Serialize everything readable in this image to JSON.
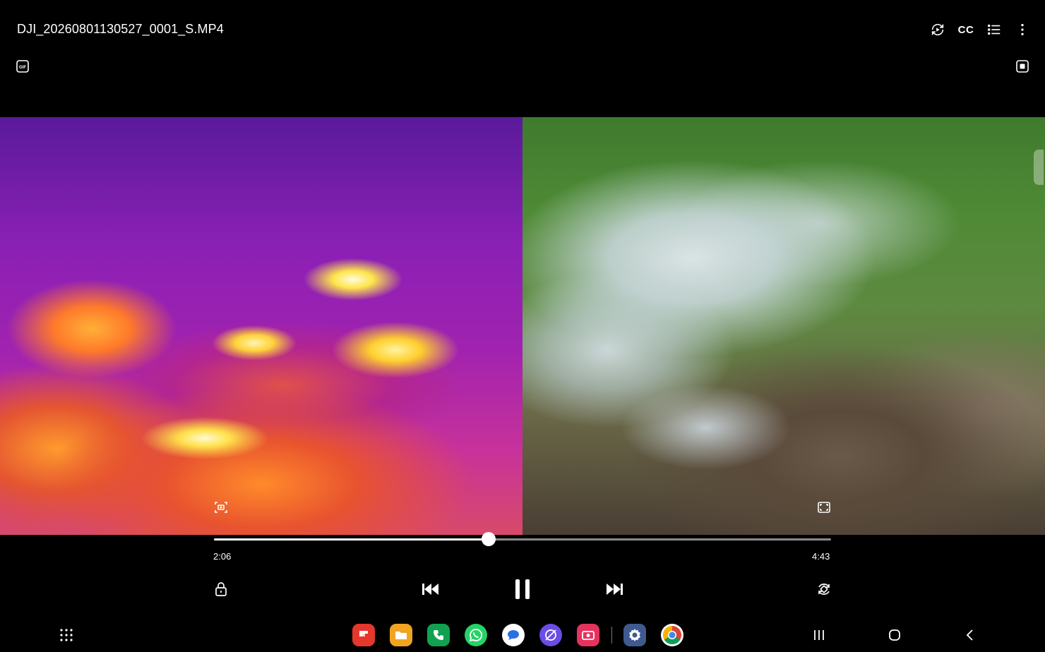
{
  "header": {
    "file_title": "DJI_20260801130527_0001_S.MP4",
    "cc_label": "CC",
    "icons": [
      "gif-icon",
      "rotate-screen-icon",
      "closed-captions-icon",
      "playlist-icon",
      "more-options-icon",
      "pop-up-player-icon"
    ]
  },
  "playback": {
    "current_time": "2:06",
    "total_time": "4:43",
    "progress_fraction": 0.445,
    "state": "playing"
  },
  "controls": {
    "icons": [
      "lock-icon",
      "previous-icon",
      "pause-icon",
      "next-icon",
      "rotate-icon",
      "capture-icon",
      "fit-screen-icon"
    ]
  },
  "video": {
    "left_view": "thermal",
    "right_view": "visible"
  },
  "dock": {
    "apps": [
      {
        "name": "flipboard-app",
        "color": "#e5372b"
      },
      {
        "name": "my-files-app",
        "color": "#f0a422"
      },
      {
        "name": "phone-app",
        "color": "#12a150"
      },
      {
        "name": "whatsapp-app",
        "color": "#25d366"
      },
      {
        "name": "messages-app",
        "color": "#ffffff"
      },
      {
        "name": "internet-app",
        "color": "#6b4de6"
      },
      {
        "name": "screen-recorder-app",
        "color": "#e5335e"
      },
      {
        "name": "settings-app",
        "color": "#3e5a90"
      },
      {
        "name": "chrome-app",
        "color": "#ffffff"
      }
    ]
  },
  "navbar": {
    "icons": [
      "app-drawer-icon",
      "recent-apps-icon",
      "home-icon",
      "back-icon"
    ]
  }
}
